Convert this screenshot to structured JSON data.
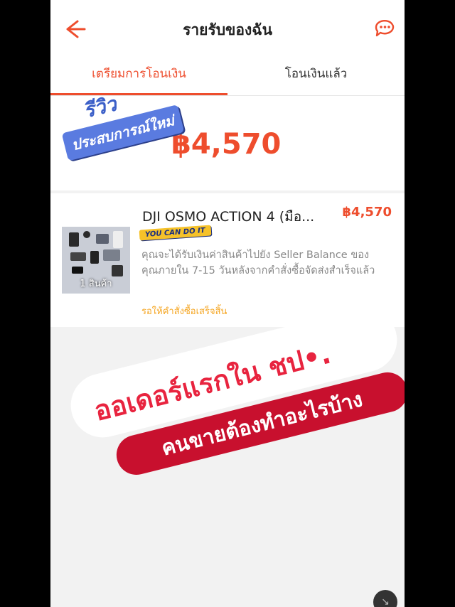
{
  "header": {
    "title": "รายรับของฉัน",
    "back_icon": "arrow-left-icon",
    "chat_icon": "chat-bubbles-icon"
  },
  "tabs": [
    {
      "label": "เตรียมการโอนเงิน",
      "active": true
    },
    {
      "label": "โอนเงินแล้ว",
      "active": false
    }
  ],
  "summary": {
    "amount": "฿4,570"
  },
  "review_badge": {
    "top": "รีวิว",
    "bottom": "ประสบการณ์ใหม่"
  },
  "order": {
    "product_name": "DJI OSMO ACTION 4 (มือ...",
    "price": "฿4,570",
    "thumb_label": "1 สินค้า",
    "sticker": "YOU CAN DO IT",
    "description": "คุณจะได้รับเงินค่าสินค้าไปยัง Seller Balance ของคุณภายใน 7-15 วันหลังจากคำสั่งซื้อจัดส่งสำเร็จแล้ว",
    "status": "รอให้คำสั่งซื้อเสร็จสิ้น"
  },
  "overlay": {
    "line1": "ออเดอร์แรกใน ชป•.",
    "line2": "คนขายต้องทำอะไรบ้าง"
  },
  "colors": {
    "accent": "#ee4d2d",
    "status": "#f5a623",
    "banner_red": "#c8102e"
  }
}
